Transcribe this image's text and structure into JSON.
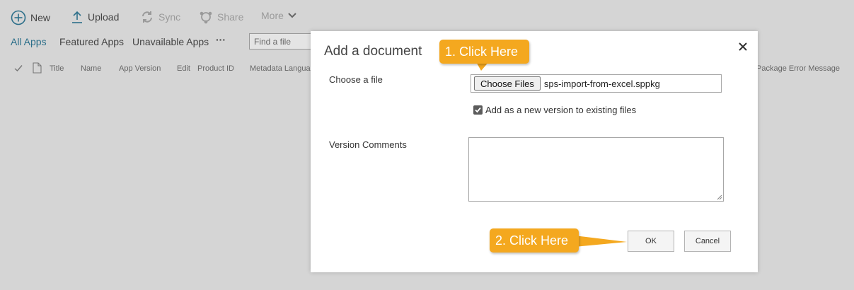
{
  "toolbar": {
    "new_label": "New",
    "upload_label": "Upload",
    "sync_label": "Sync",
    "share_label": "Share",
    "more_label": "More"
  },
  "views": {
    "tabs": [
      "All Apps",
      "Featured Apps",
      "Unavailable Apps"
    ],
    "overflow": "···",
    "find_placeholder": "Find a file"
  },
  "columns": [
    "Title",
    "Name",
    "App Version",
    "Edit",
    "Product ID",
    "Metadata Langua",
    "Package Error Message"
  ],
  "dialog": {
    "title": "Add a document",
    "choose_label": "Choose a file",
    "choose_button": "Choose Files",
    "file_name": "sps-import-from-excel.sppkg",
    "checkbox_label": "Add as a new version to existing files",
    "checkbox_checked": true,
    "comments_label": "Version Comments",
    "ok_label": "OK",
    "cancel_label": "Cancel"
  },
  "callouts": {
    "step1": "1. Click Here",
    "step2": "2. Click Here"
  },
  "colors": {
    "callout": "#f4a81f",
    "accent": "#2c6f8a",
    "overlay": "#d5d5d5"
  }
}
